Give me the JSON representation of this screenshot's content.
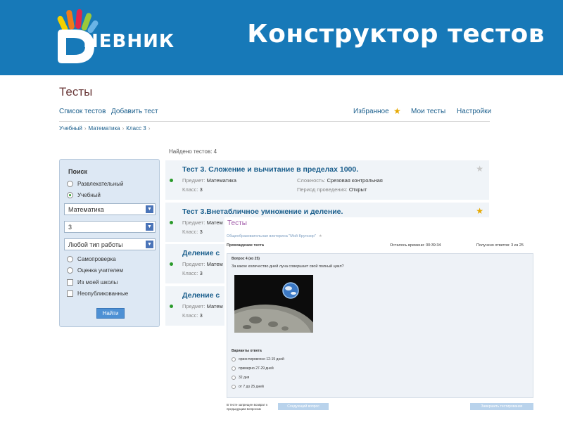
{
  "banner": {
    "logo_text": "НЕВНИК",
    "title": "Конструктор тестов"
  },
  "page": {
    "title": "Тесты",
    "nav_left": [
      "Список тестов",
      "Добавить тест"
    ],
    "nav_right": {
      "favorites": "Избранное",
      "my_tests": "Мои тесты",
      "settings": "Настройки"
    },
    "breadcrumb": [
      "Учебный",
      "Математика",
      "Класс 3"
    ],
    "found_label": "Найдено тестов:",
    "found_count": "4"
  },
  "search": {
    "heading": "Поиск",
    "radio_top": [
      {
        "label": "Развлекательный",
        "checked": false
      },
      {
        "label": "Учебный",
        "checked": true
      }
    ],
    "selects": [
      "Математика",
      "3",
      "Любой тип работы"
    ],
    "radio_bottom": [
      {
        "label": "Самопроверка"
      },
      {
        "label": "Оценка учителем"
      }
    ],
    "checkboxes": [
      {
        "label": "Из моей школы"
      },
      {
        "label": "Неопубликованные"
      }
    ],
    "button": "Найти"
  },
  "results": [
    {
      "title": "Тест 3. Сложение и вычитание в пределах 1000.",
      "subject_label": "Предмет:",
      "subject": "Математика",
      "grade_label": "Класс:",
      "grade": "3",
      "difficulty_label": "Сложность:",
      "difficulty": "Срезовая контрольная",
      "period_label": "Период проведения:",
      "period": "Открыт",
      "favorite": false
    },
    {
      "title": "Тест 3.Внетабличное умножение и деление.",
      "subject_label": "Предмет:",
      "subject": "Матем",
      "grade_label": "Класс:",
      "grade": "3",
      "favorite": true
    },
    {
      "title": "Деление с",
      "subject_label": "Предмет:",
      "subject": "Матем",
      "grade_label": "Класс:",
      "grade": "3"
    },
    {
      "title": "Деление с",
      "subject_label": "Предмет:",
      "subject": "Матем",
      "grade_label": "Класс:",
      "grade": "3"
    }
  ],
  "overlay": {
    "title": "Тесты",
    "subtitle": "Общеобразовательная викторина \"Мой Кругозор\"",
    "passing": "Прохождение теста",
    "time_left": "Осталось времени: 00:39:34",
    "answers_received": "Получено ответов: 3 из 25",
    "question_no": "Вопрос 4 (из 25)",
    "question_text": "За какое количество дней луна совершает свой полный цикл?",
    "answers_heading": "Варианты ответа",
    "answers": [
      "ориентировочно 12-15 дней",
      "примерно 27-29 дней",
      "32 дня",
      "от 7 до 25 дней"
    ],
    "footer_note": "В тесте запрещен возврат к предыдущим вопросам",
    "next_button": "Следующий вопрос",
    "finish_button": "Завершить тестирование"
  }
}
